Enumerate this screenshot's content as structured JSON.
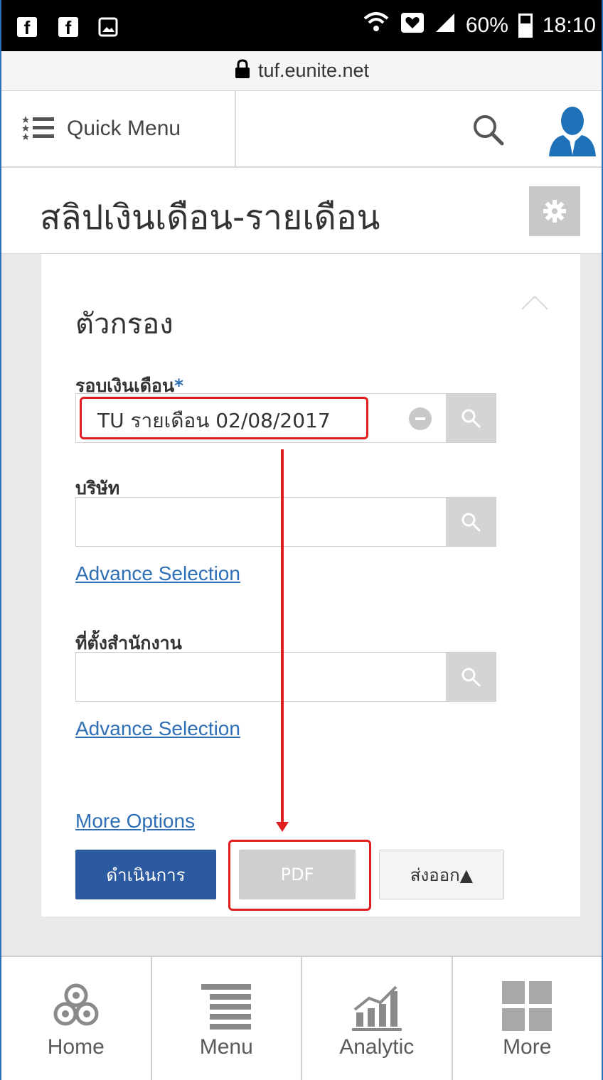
{
  "status_bar": {
    "left_icons": [
      "facebook-icon",
      "facebook-icon",
      "image-icon"
    ],
    "battery": "60%",
    "time": "18:10"
  },
  "browser": {
    "url": "tuf.eunite.net"
  },
  "header": {
    "quick_menu_label": "Quick Menu"
  },
  "page": {
    "title": "สลิปเงินเดือน-รายเดือน"
  },
  "filter": {
    "title": "ตัวกรอง",
    "payroll_round": {
      "label": "รอบเงินเดือน",
      "required_mark": "*",
      "value": "TU รายเดือน 02/08/2017"
    },
    "company": {
      "label": "บริษัท",
      "value": ""
    },
    "advance_selection_1": "Advance Selection",
    "office_location": {
      "label": "ที่ตั้งสำนักงาน",
      "value": ""
    },
    "advance_selection_2": "Advance Selection",
    "more_options": "More Options",
    "buttons": {
      "run": "ดำเนินการ",
      "pdf": "PDF",
      "export": "ส่งออก▲"
    }
  },
  "bottom_nav": {
    "items": [
      {
        "label": "Home",
        "icon": "home-icon"
      },
      {
        "label": "Menu",
        "icon": "menu-icon"
      },
      {
        "label": "Analytic",
        "icon": "analytic-icon"
      },
      {
        "label": "More",
        "icon": "more-grid-icon"
      }
    ]
  },
  "colors": {
    "accent": "#2e6fb5",
    "primary_button": "#2c5aa0",
    "annotation_red": "#e01e1e"
  }
}
